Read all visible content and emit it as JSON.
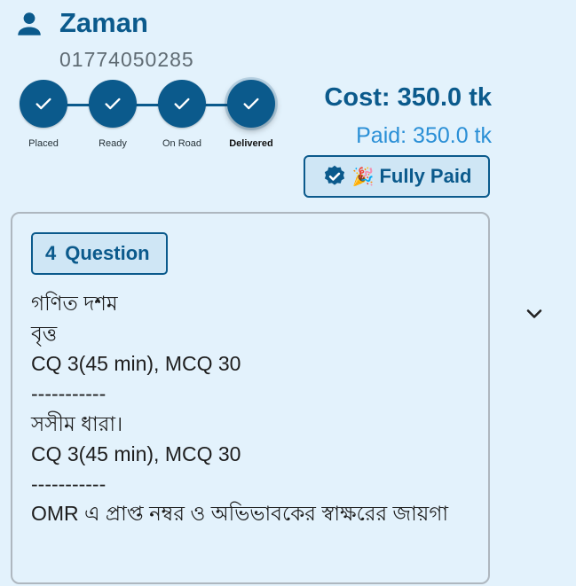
{
  "header": {
    "name": "Zaman",
    "phone": "01774050285"
  },
  "stepper": {
    "steps": [
      {
        "label": "Placed",
        "done": true
      },
      {
        "label": "Ready",
        "done": true
      },
      {
        "label": "On Road",
        "done": true
      },
      {
        "label": "Delivered",
        "done": true,
        "current": true
      }
    ]
  },
  "payment": {
    "cost": "Cost: 350.0 tk",
    "paid": "Paid: 350.0 tk",
    "status_emoji": "🎉",
    "status": "Fully Paid"
  },
  "question": {
    "count": "4",
    "label": "Question",
    "lines": [
      "গণিত দশম",
      "বৃত্ত",
      "CQ 3(45 min), MCQ 30",
      "-----------",
      "সসীম ধারা।",
      "CQ 3(45 min), MCQ 30",
      "-----------",
      "OMR এ প্রাপ্ত নম্বর ও অভিভাবকের স্বাক্ষরের জায়গা"
    ]
  },
  "icons": {
    "user": "person-icon",
    "check": "check-icon",
    "verified": "verified-badge-icon",
    "expand": "chevron-down-icon"
  },
  "colors": {
    "primary": "#0b5a8c",
    "paid": "#2a8fd6",
    "background": "#e3f2fc"
  }
}
